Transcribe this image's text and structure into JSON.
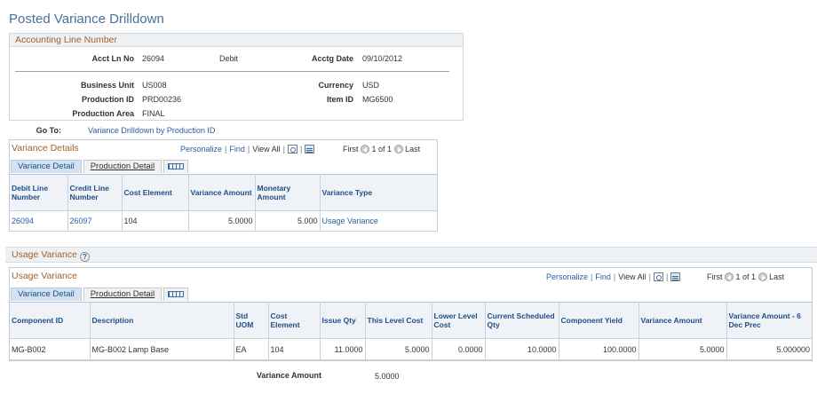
{
  "page_title": "Posted Variance Drilldown",
  "accounting": {
    "header": "Accounting Line Number",
    "acct_ln_no_label": "Acct Ln No",
    "acct_ln_no": "26094",
    "debit": "Debit",
    "acctg_date_label": "Acctg Date",
    "acctg_date": "09/10/2012",
    "business_unit_label": "Business Unit",
    "business_unit": "US008",
    "currency_label": "Currency",
    "currency": "USD",
    "production_id_label": "Production ID",
    "production_id": "PRD00236",
    "item_id_label": "Item ID",
    "item_id": "MG6500",
    "production_area_label": "Production Area",
    "production_area": "FINAL"
  },
  "goto": {
    "label": "Go To:",
    "link": "Variance Drilldown by Production ID"
  },
  "variance_details": {
    "title": "Variance Details",
    "nav": {
      "personalize": "Personalize",
      "find": "Find",
      "view_all": "View All",
      "first": "First",
      "count": "1 of 1",
      "last": "Last"
    },
    "tabs": {
      "active": "Variance Detail",
      "inactive": "Production Detail"
    },
    "columns": [
      "Debit Line Number",
      "Credit Line Number",
      "Cost Element",
      "Variance Amount",
      "Monetary Amount",
      "Variance Type"
    ],
    "rows": [
      {
        "debit_line": "26094",
        "credit_line": "26097",
        "cost_element": "104",
        "variance_amount": "5.0000",
        "monetary_amount": "5.000",
        "variance_type": "Usage Variance"
      }
    ]
  },
  "usage_section": {
    "header": "Usage Variance",
    "help_glyph": "?"
  },
  "usage_grid": {
    "title": "Usage Variance",
    "nav": {
      "personalize": "Personalize",
      "find": "Find",
      "view_all": "View All",
      "first": "First",
      "count": "1 of 1",
      "last": "Last"
    },
    "tabs": {
      "active": "Variance Detail",
      "inactive": "Production Detail"
    },
    "columns": [
      "Component ID",
      "Description",
      "Std UOM",
      "Cost Element",
      "Issue Qty",
      "This Level Cost",
      "Lower Level Cost",
      "Current Scheduled Qty",
      "Component Yield",
      "Variance Amount",
      "Variance Amount - 6 Dec Prec"
    ],
    "rows": [
      {
        "component_id": "MG-B002",
        "description": "MG-B002 Lamp Base",
        "std_uom": "EA",
        "cost_element": "104",
        "issue_qty": "11.0000",
        "this_level_cost": "5.0000",
        "lower_level_cost": "0.0000",
        "current_scheduled_qty": "10.0000",
        "component_yield": "100.0000",
        "variance_amount": "5.0000",
        "variance_amount_6dec": "5.000000"
      }
    ]
  },
  "total": {
    "label": "Variance Amount",
    "value": "5.0000"
  },
  "colors": {
    "title_blue": "#4b6e9b",
    "section_orange": "#a1602b",
    "link_blue": "#2a5d9f",
    "header_bg": "#eff3f7",
    "active_tab_bg": "#d3e2f2"
  },
  "icons": {
    "zoom": "zoom-icon",
    "download": "download-spreadsheet-icon",
    "prev": "previous-row-icon",
    "next": "next-row-icon",
    "columns": "show-all-columns-icon",
    "help": "help-icon"
  }
}
